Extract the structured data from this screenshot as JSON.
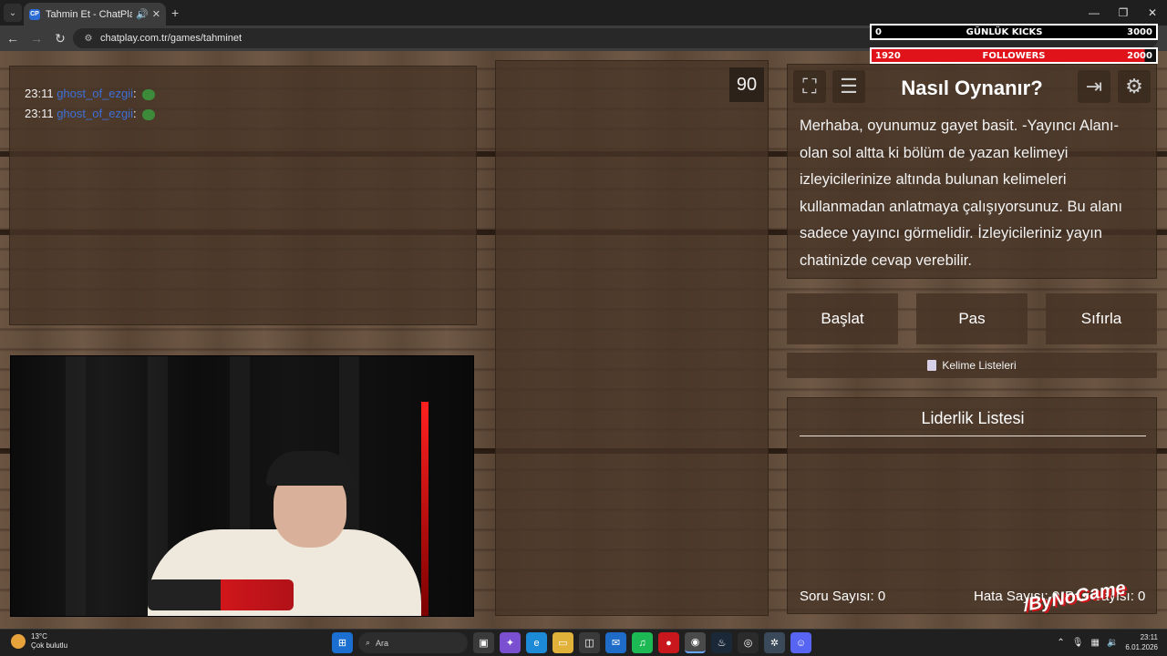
{
  "browser": {
    "tab_title": "Tahmin Et - ChatPlay",
    "url": "chatplay.com.tr/games/tahminet",
    "favicon_text": "CP"
  },
  "chat": {
    "messages": [
      {
        "time": "23:11",
        "user": "ghost_of_ezgii",
        "sep": ":"
      },
      {
        "time": "23:11",
        "user": "ghost_of_ezgii",
        "sep": ":"
      }
    ]
  },
  "timer": "90",
  "howto": {
    "title": "Nasıl Oynanır?",
    "text": "Merhaba, oyunumuz gayet basit. -Yayıncı Alanı- olan sol altta ki bölüm de yazan kelimeyi izleyicilerinize altında bulunan kelimeleri kullanmadan anlatmaya çalışıyorsunuz. Bu alanı sadece yayıncı görmelidir. İzleyicileriniz yayın chatinizde cevap verebilir."
  },
  "controls": {
    "start": "Başlat",
    "pass": "Pas",
    "reset": "Sıfırla",
    "word_lists": "Kelime Listeleri"
  },
  "leaderboard": {
    "title": "Liderlik Listesi",
    "question_count": "Soru Sayısı: 0",
    "error_count": "Hata Sayısı: 0",
    "pass_count": "Pas Sayısı: 0"
  },
  "overlay": {
    "kicks_left": "0",
    "kicks_label": "GÜNLÜK KICKS",
    "kicks_right": "3000",
    "followers_left": "1920",
    "followers_label": "FOLLOWERS",
    "followers_right": "2000",
    "logo_text": "/ByNoGame"
  },
  "taskbar": {
    "temp": "13°C",
    "weather": "Çok bulutlu",
    "search": "Ara",
    "time": "23:11",
    "date": "6.01.2026"
  },
  "colors": {
    "accent_red": "#e0121a",
    "chat_user": "#3d6fd6"
  }
}
